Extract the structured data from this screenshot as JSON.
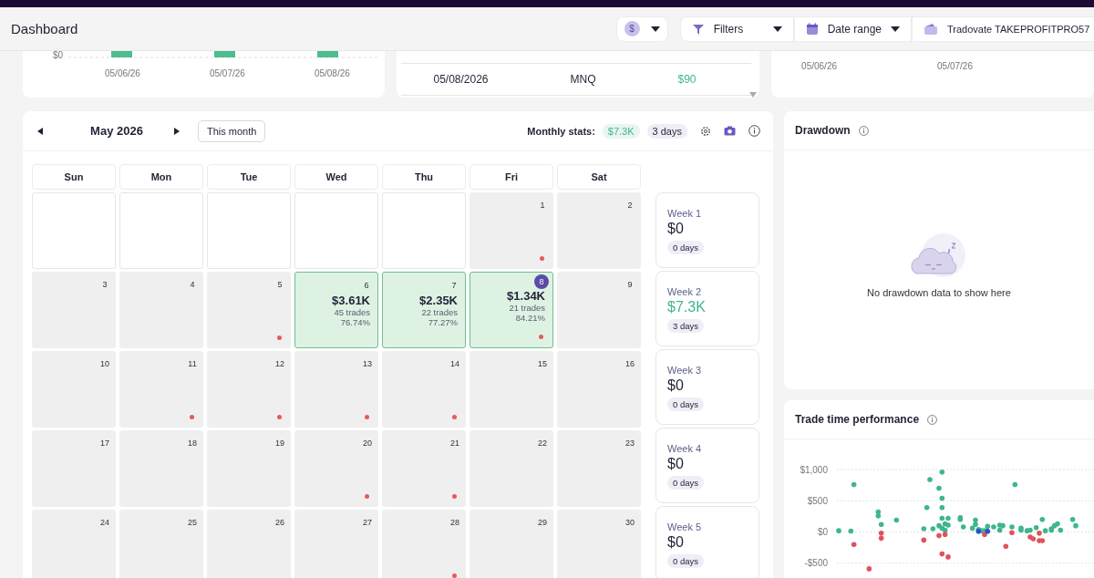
{
  "header": {
    "title": "Dashboard",
    "currency": {
      "symbol": "$"
    },
    "filters": {
      "label": "Filters"
    },
    "date_range": {
      "label": "Date range"
    },
    "account": {
      "label": "Tradovate TAKEPROFITPRO57"
    }
  },
  "top_cards": {
    "pnl_chart": {
      "ytick": "$0",
      "xlabels": [
        "05/06/26",
        "05/07/26",
        "05/08/26"
      ]
    },
    "trades_table": {
      "rows": [
        {
          "date": "05/08/2026",
          "symbol": "MNQ",
          "pnl": "$90"
        }
      ]
    },
    "right_chart": {
      "xlabels": [
        "05/06/26",
        "05/07/26"
      ]
    }
  },
  "calendar": {
    "month": "May 2026",
    "today_button": "This month",
    "stats_label": "Monthly stats:",
    "stats_pnl": "$7.3K",
    "stats_days": "3 days",
    "weekdays": [
      "Sun",
      "Mon",
      "Tue",
      "Wed",
      "Thu",
      "Fri",
      "Sat"
    ],
    "days": [
      {
        "kind": "blank"
      },
      {
        "kind": "blank"
      },
      {
        "kind": "blank"
      },
      {
        "kind": "blank"
      },
      {
        "kind": "blank"
      },
      {
        "kind": "day",
        "day": "1",
        "dot": true,
        "today": false
      },
      {
        "kind": "day",
        "day": "2",
        "dot": false,
        "today": false
      },
      {
        "kind": "day",
        "day": "3",
        "dot": false,
        "today": false
      },
      {
        "kind": "day",
        "day": "4",
        "dot": false,
        "today": false
      },
      {
        "kind": "day",
        "day": "5",
        "dot": true,
        "today": false
      },
      {
        "kind": "profit",
        "day": "6",
        "pnl": "$3.61K",
        "trades": "45 trades",
        "winrate": "76.74%",
        "dot": false,
        "today": false
      },
      {
        "kind": "profit",
        "day": "7",
        "pnl": "$2.35K",
        "trades": "22 trades",
        "winrate": "77.27%",
        "dot": false,
        "today": false
      },
      {
        "kind": "profit",
        "day": "8",
        "pnl": "$1.34K",
        "trades": "21 trades",
        "winrate": "84.21%",
        "dot": true,
        "today": true
      },
      {
        "kind": "day",
        "day": "9",
        "dot": false,
        "today": false
      },
      {
        "kind": "day",
        "day": "10",
        "dot": false,
        "today": false
      },
      {
        "kind": "day",
        "day": "11",
        "dot": true,
        "today": false
      },
      {
        "kind": "day",
        "day": "12",
        "dot": true,
        "today": false
      },
      {
        "kind": "day",
        "day": "13",
        "dot": true,
        "today": false
      },
      {
        "kind": "day",
        "day": "14",
        "dot": true,
        "today": false
      },
      {
        "kind": "day",
        "day": "15",
        "dot": false,
        "today": false
      },
      {
        "kind": "day",
        "day": "16",
        "dot": false,
        "today": false
      },
      {
        "kind": "day",
        "day": "17",
        "dot": false,
        "today": false
      },
      {
        "kind": "day",
        "day": "18",
        "dot": false,
        "today": false
      },
      {
        "kind": "day",
        "day": "19",
        "dot": false,
        "today": false
      },
      {
        "kind": "day",
        "day": "20",
        "dot": true,
        "today": false
      },
      {
        "kind": "day",
        "day": "21",
        "dot": true,
        "today": false
      },
      {
        "kind": "day",
        "day": "22",
        "dot": false,
        "today": false
      },
      {
        "kind": "day",
        "day": "23",
        "dot": false,
        "today": false
      },
      {
        "kind": "day",
        "day": "24",
        "dot": false,
        "today": false
      },
      {
        "kind": "day",
        "day": "25",
        "dot": false,
        "today": false
      },
      {
        "kind": "day",
        "day": "26",
        "dot": false,
        "today": false
      },
      {
        "kind": "day",
        "day": "27",
        "dot": false,
        "today": false
      },
      {
        "kind": "day",
        "day": "28",
        "dot": true,
        "today": false
      },
      {
        "kind": "day",
        "day": "29",
        "dot": false,
        "today": false
      },
      {
        "kind": "day",
        "day": "30",
        "dot": false,
        "today": false
      }
    ],
    "weeks": [
      {
        "label": "Week 1",
        "pnl": "$0",
        "positive": false,
        "days": "0 days"
      },
      {
        "label": "Week 2",
        "pnl": "$7.3K",
        "positive": true,
        "days": "3 days"
      },
      {
        "label": "Week 3",
        "pnl": "$0",
        "positive": false,
        "days": "0 days"
      },
      {
        "label": "Week 4",
        "pnl": "$0",
        "positive": false,
        "days": "0 days"
      },
      {
        "label": "Week 5",
        "pnl": "$0",
        "positive": false,
        "days": "0 days"
      }
    ]
  },
  "drawdown": {
    "title": "Drawdown",
    "message": "No drawdown data to show here"
  },
  "trade_time": {
    "title": "Trade time performance",
    "axis_labels": [
      "$1,000",
      "$500",
      "$0",
      "-$500"
    ]
  }
}
